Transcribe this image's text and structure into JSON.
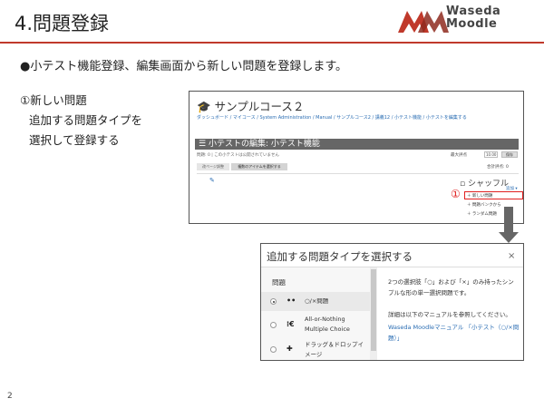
{
  "slide": {
    "title": "4.問題登録",
    "logo_line1": "Waseda",
    "logo_line2": "Moodle",
    "bullet": "●小テスト機能登録、編集画面から新しい問題を登録します。",
    "step_heading": "①新しい問題",
    "step_line2": "追加する問題タイプを",
    "step_line3": "選択して登録する",
    "page_number": "2"
  },
  "quiz_screen": {
    "course_title": "サンプルコース２",
    "breadcrumbs": "ダッシュボード / マイコース / System Administration / Manual / サンプルコース2 / 講義12 / 小テスト機能 / 小テストを編集する",
    "edit_title": "小テストの編集: 小テスト機能",
    "note": "問題: 0 | この小テストは公開されていません",
    "max_grade_label": "最大評点",
    "max_grade_value": "10.00",
    "save_button": "保存",
    "tab_repaginate": "改ページ調整",
    "tab_select_multiple": "複数のアイテムを選択する",
    "total_marks": "合計評点: 0",
    "shuffle_label": "シャッフル",
    "add_link": "追加 ▾",
    "marker": "①",
    "menu_new_question": "＋ 新しい問題",
    "menu_question_bank": "＋ 問題バンクから",
    "menu_random": "＋ ランダム問題"
  },
  "dialog": {
    "title": "追加する問題タイプを選択する",
    "close": "×",
    "list_header": "問題",
    "options": [
      {
        "icon": "••",
        "label": "○/×問題",
        "checked": true
      },
      {
        "icon": "⁝€",
        "label": "All-or-Nothing Multiple Choice",
        "checked": false
      },
      {
        "icon": "✚",
        "label": "ドラッグ＆ドロップイメージ",
        "checked": false
      }
    ],
    "description": "2つの選択肢「○」および「×」のみ持ったシンプルな形の単一選択問題です。",
    "help_text": "詳細は以下のマニュアルを参照してください。",
    "help_link": "Waseda Moodleマニュアル 「小テスト（○/×問題）」"
  },
  "colors": {
    "title_rule": "#c0392b",
    "logo_red": "#c0392b",
    "link_blue": "#2a6db3",
    "highlight_red": "#e02020"
  }
}
